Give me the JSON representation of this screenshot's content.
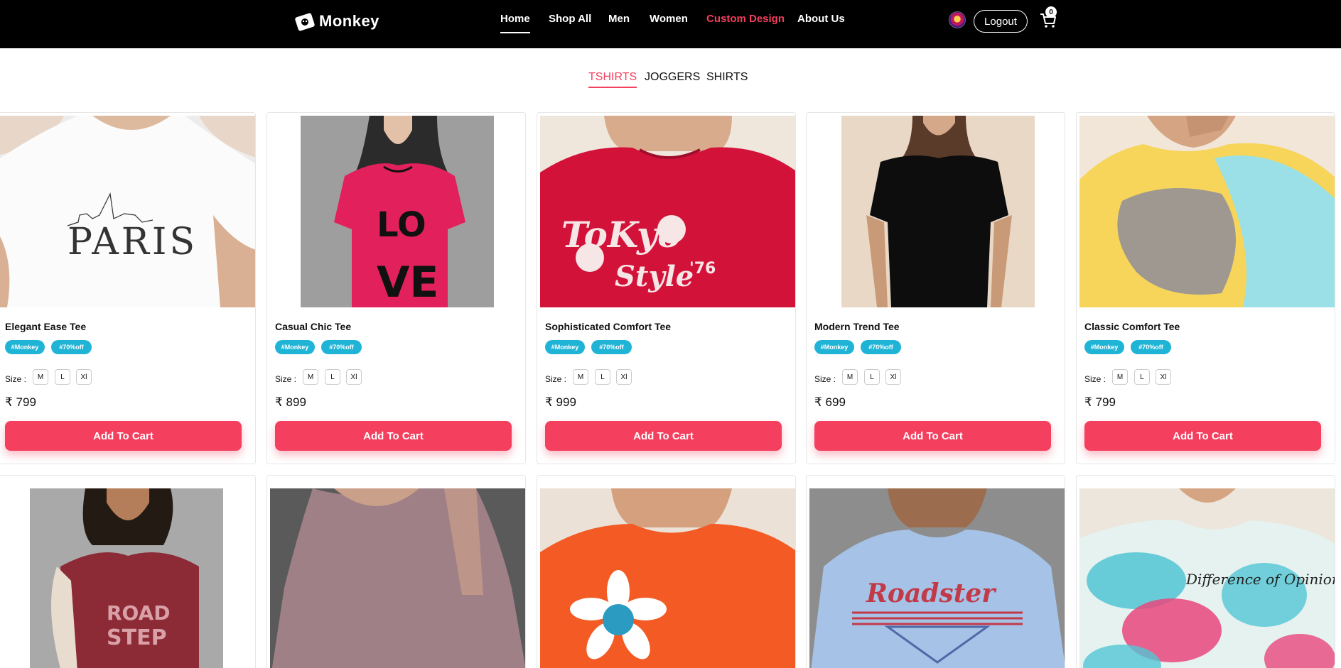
{
  "navbar": {
    "logo_text": "Monkey",
    "links": [
      "Home",
      "Shop All",
      "Men",
      "Women",
      "Custom Design",
      "About Us"
    ],
    "logout_label": "Logout",
    "cart_count": "0"
  },
  "tabs": [
    "TSHIRTS",
    "JOGGERS",
    "SHIRTS"
  ],
  "size_label": "Size :",
  "sizes": [
    "M",
    "L",
    "Xl"
  ],
  "add_label": "Add To Cart",
  "products": [
    {
      "title": "Elegant Ease Tee",
      "tags": [
        "#Monkey",
        "#70%off"
      ],
      "price": "₹ 799"
    },
    {
      "title": "Casual Chic Tee",
      "tags": [
        "#Monkey",
        "#70%off"
      ],
      "price": "₹ 899"
    },
    {
      "title": "Sophisticated Comfort Tee",
      "tags": [
        "#Monkey",
        "#70%off"
      ],
      "price": "₹ 999"
    },
    {
      "title": "Modern Trend Tee",
      "tags": [
        "#Monkey",
        "#70%off"
      ],
      "price": "₹ 699"
    },
    {
      "title": "Classic Comfort Tee",
      "tags": [
        "#Monkey",
        "#70%off"
      ],
      "price": "₹ 799"
    }
  ],
  "colors": {
    "accent": "#f43f5e",
    "tag": "#1fb4d6",
    "nav_bg": "#000000"
  }
}
